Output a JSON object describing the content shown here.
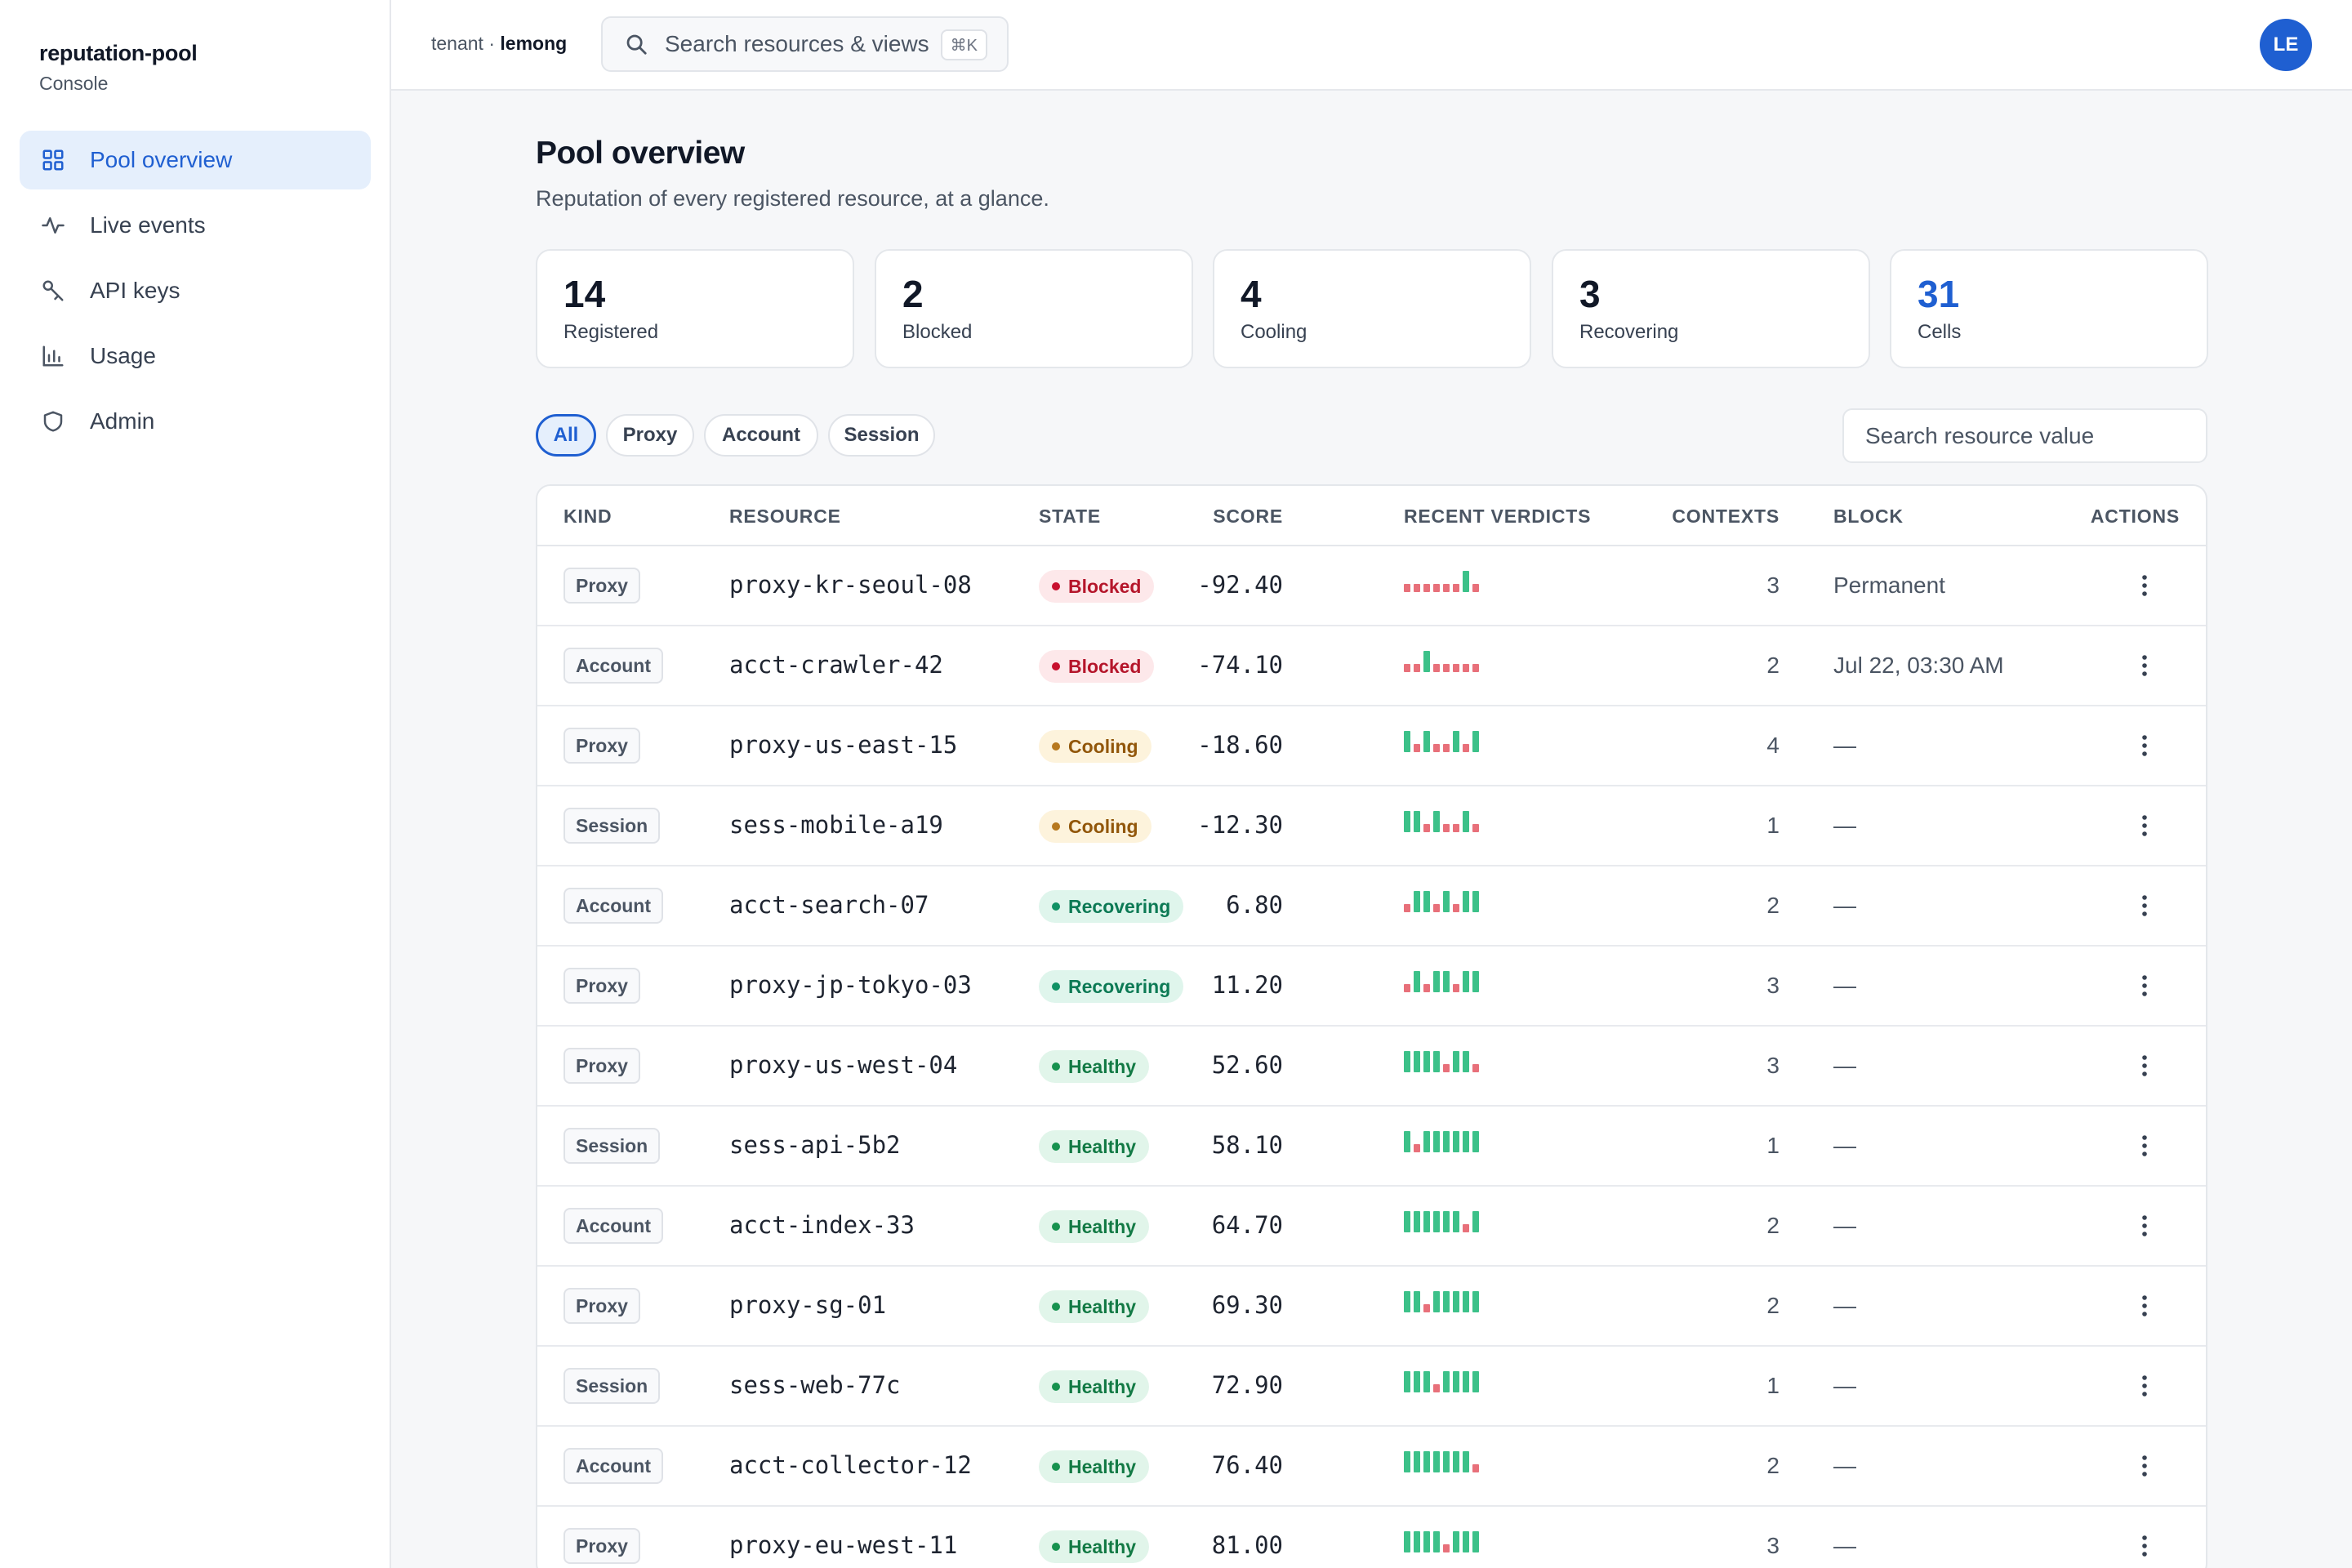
{
  "brand": {
    "name": "reputation-pool",
    "sub": "Console"
  },
  "nav": [
    {
      "label": "Pool overview",
      "icon": "grid-icon",
      "active": true
    },
    {
      "label": "Live events",
      "icon": "activity-icon",
      "active": false
    },
    {
      "label": "API keys",
      "icon": "key-icon",
      "active": false
    },
    {
      "label": "Usage",
      "icon": "bar-chart-icon",
      "active": false
    },
    {
      "label": "Admin",
      "icon": "shield-icon",
      "active": false
    }
  ],
  "topbar": {
    "tenant_prefix": "tenant · ",
    "tenant_name": "lemong",
    "search_placeholder": "Search resources & views",
    "shortcut": "⌘K",
    "avatar": "LE"
  },
  "page": {
    "title": "Pool overview",
    "subtitle": "Reputation of every registered resource, at a glance."
  },
  "stats": [
    {
      "value": "14",
      "label": "Registered"
    },
    {
      "value": "2",
      "label": "Blocked"
    },
    {
      "value": "4",
      "label": "Cooling"
    },
    {
      "value": "3",
      "label": "Recovering"
    },
    {
      "value": "31",
      "label": "Cells",
      "accent": "#1f5fd1"
    }
  ],
  "filters": [
    "All",
    "Proxy",
    "Account",
    "Session"
  ],
  "active_filter": "All",
  "resource_search_placeholder": "Search resource value",
  "colors": {
    "accent": "#1f5fd1",
    "verdict_good": "#3cc189",
    "verdict_bad": "#e8707a"
  },
  "table": {
    "headers": [
      "KIND",
      "RESOURCE",
      "STATE",
      "SCORE",
      "RECENT VERDICTS",
      "CONTEXTS",
      "BLOCK",
      "ACTIONS"
    ],
    "rows": [
      {
        "kind": "Proxy",
        "resource": "proxy-kr-seoul-08",
        "state": "Blocked",
        "score": "-92.40",
        "verdicts": "BBBBBBGB",
        "contexts": "3",
        "block": "Permanent"
      },
      {
        "kind": "Account",
        "resource": "acct-crawler-42",
        "state": "Blocked",
        "score": "-74.10",
        "verdicts": "BBGBBBBB",
        "contexts": "2",
        "block": "Jul 22, 03:30 AM"
      },
      {
        "kind": "Proxy",
        "resource": "proxy-us-east-15",
        "state": "Cooling",
        "score": "-18.60",
        "verdicts": "GBGBBGBG",
        "contexts": "4",
        "block": "—"
      },
      {
        "kind": "Session",
        "resource": "sess-mobile-a19",
        "state": "Cooling",
        "score": "-12.30",
        "verdicts": "GGBGBBGB",
        "contexts": "1",
        "block": "—"
      },
      {
        "kind": "Account",
        "resource": "acct-search-07",
        "state": "Recovering",
        "score": "6.80",
        "verdicts": "BGGBGBGG",
        "contexts": "2",
        "block": "—"
      },
      {
        "kind": "Proxy",
        "resource": "proxy-jp-tokyo-03",
        "state": "Recovering",
        "score": "11.20",
        "verdicts": "BGBGGBGG",
        "contexts": "3",
        "block": "—"
      },
      {
        "kind": "Proxy",
        "resource": "proxy-us-west-04",
        "state": "Healthy",
        "score": "52.60",
        "verdicts": "GGGGBGGB",
        "contexts": "3",
        "block": "—"
      },
      {
        "kind": "Session",
        "resource": "sess-api-5b2",
        "state": "Healthy",
        "score": "58.10",
        "verdicts": "GBGGGGGG",
        "contexts": "1",
        "block": "—"
      },
      {
        "kind": "Account",
        "resource": "acct-index-33",
        "state": "Healthy",
        "score": "64.70",
        "verdicts": "GGGGGGBG",
        "contexts": "2",
        "block": "—"
      },
      {
        "kind": "Proxy",
        "resource": "proxy-sg-01",
        "state": "Healthy",
        "score": "69.30",
        "verdicts": "GGBGGGGG",
        "contexts": "2",
        "block": "—"
      },
      {
        "kind": "Session",
        "resource": "sess-web-77c",
        "state": "Healthy",
        "score": "72.90",
        "verdicts": "GGGBGGGG",
        "contexts": "1",
        "block": "—"
      },
      {
        "kind": "Account",
        "resource": "acct-collector-12",
        "state": "Healthy",
        "score": "76.40",
        "verdicts": "GGGGGGGB",
        "contexts": "2",
        "block": "—"
      },
      {
        "kind": "Proxy",
        "resource": "proxy-eu-west-11",
        "state": "Healthy",
        "score": "81.00",
        "verdicts": "GGGGBGGG",
        "contexts": "3",
        "block": "—"
      }
    ]
  }
}
